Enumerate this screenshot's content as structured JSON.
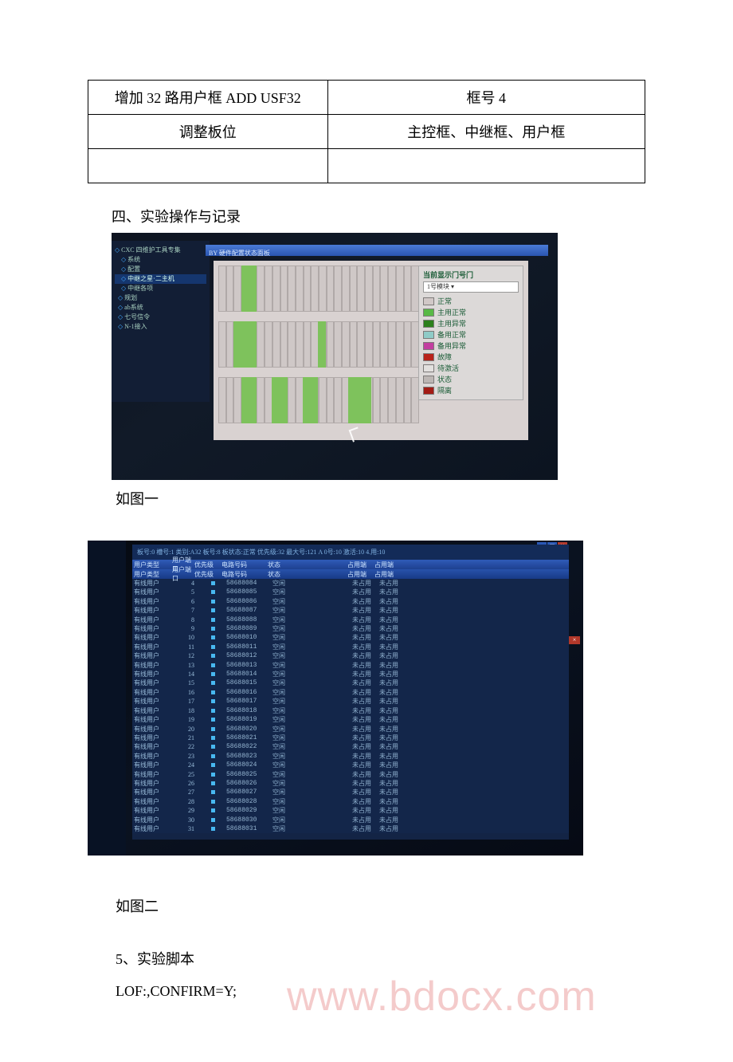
{
  "table": {
    "rows": [
      {
        "left": "增加 32 路用户框 ADD USF32",
        "right": "框号 4"
      },
      {
        "left": "调整板位",
        "right": "主控框、中继框、用户框"
      },
      {
        "left": "",
        "right": ""
      }
    ]
  },
  "heading_section4": "四、实验操作与记录",
  "caption1": "如图一",
  "caption2": "如图二",
  "heading_script": "5、实验脚本",
  "script_line1": "LOF:,CONFIRM=Y;",
  "watermark": "www.bdocx.com",
  "shot1": {
    "titlebar": "BY 硬件配置状态面板",
    "tree": [
      "CXC 四维护工具专集",
      "系统",
      "配置",
      "中继之星·二主机",
      "中继各项",
      "规划",
      "ab系统",
      "七号信令",
      "N-1接入"
    ],
    "tree_selected_index": 3,
    "legend": {
      "title": "当前显示门号门",
      "selector": "1号模块  ▾",
      "items": [
        {
          "label": "正常",
          "color": "#d1c8c7"
        },
        {
          "label": "主用正常",
          "color": "#58b946"
        },
        {
          "label": "主用异常",
          "color": "#2c801c"
        },
        {
          "label": "备用正常",
          "color": "#8fcbc7"
        },
        {
          "label": "备用异常",
          "color": "#c23fa0"
        },
        {
          "label": "故障",
          "color": "#b8231a"
        },
        {
          "label": "待激活",
          "color": "#e2e0de"
        },
        {
          "label": "状态",
          "color": "#bcb6b4"
        },
        {
          "label": "隔离",
          "color": "#a31c16"
        }
      ]
    }
  },
  "shot2": {
    "header_status": "板号:0   槽号:1   类别:A32   板号:8   板状态:正常   优先级:32   最大号:121 A 0号:10 激活:10 4.用:10",
    "column_groups": [
      "用户类型",
      "用户端口",
      "优先级",
      "电路号码",
      "状态",
      "占用端",
      "占用端"
    ],
    "rows": [
      {
        "type": "有线用户",
        "port": 4,
        "id": "58688084",
        "st": "空闲",
        "oc1": "未占用",
        "oc2": "未占用"
      },
      {
        "type": "有线用户",
        "port": 5,
        "id": "58688085",
        "st": "空闲",
        "oc1": "未占用",
        "oc2": "未占用"
      },
      {
        "type": "有线用户",
        "port": 6,
        "id": "58688086",
        "st": "空闲",
        "oc1": "未占用",
        "oc2": "未占用"
      },
      {
        "type": "有线用户",
        "port": 7,
        "id": "58688087",
        "st": "空闲",
        "oc1": "未占用",
        "oc2": "未占用"
      },
      {
        "type": "有线用户",
        "port": 8,
        "id": "58688088",
        "st": "空闲",
        "oc1": "未占用",
        "oc2": "未占用"
      },
      {
        "type": "有线用户",
        "port": 9,
        "id": "58688089",
        "st": "空闲",
        "oc1": "未占用",
        "oc2": "未占用"
      },
      {
        "type": "有线用户",
        "port": 10,
        "id": "58688010",
        "st": "空闲",
        "oc1": "未占用",
        "oc2": "未占用"
      },
      {
        "type": "有线用户",
        "port": 11,
        "id": "58688011",
        "st": "空闲",
        "oc1": "未占用",
        "oc2": "未占用"
      },
      {
        "type": "有线用户",
        "port": 12,
        "id": "58688012",
        "st": "空闲",
        "oc1": "未占用",
        "oc2": "未占用"
      },
      {
        "type": "有线用户",
        "port": 13,
        "id": "58688013",
        "st": "空闲",
        "oc1": "未占用",
        "oc2": "未占用"
      },
      {
        "type": "有线用户",
        "port": 14,
        "id": "58688014",
        "st": "空闲",
        "oc1": "未占用",
        "oc2": "未占用"
      },
      {
        "type": "有线用户",
        "port": 15,
        "id": "58688015",
        "st": "空闲",
        "oc1": "未占用",
        "oc2": "未占用"
      },
      {
        "type": "有线用户",
        "port": 16,
        "id": "58688016",
        "st": "空闲",
        "oc1": "未占用",
        "oc2": "未占用"
      },
      {
        "type": "有线用户",
        "port": 17,
        "id": "58688017",
        "st": "空闲",
        "oc1": "未占用",
        "oc2": "未占用"
      },
      {
        "type": "有线用户",
        "port": 18,
        "id": "58688018",
        "st": "空闲",
        "oc1": "未占用",
        "oc2": "未占用"
      },
      {
        "type": "有线用户",
        "port": 19,
        "id": "58688019",
        "st": "空闲",
        "oc1": "未占用",
        "oc2": "未占用"
      },
      {
        "type": "有线用户",
        "port": 20,
        "id": "58688020",
        "st": "空闲",
        "oc1": "未占用",
        "oc2": "未占用"
      },
      {
        "type": "有线用户",
        "port": 21,
        "id": "58688021",
        "st": "空闲",
        "oc1": "未占用",
        "oc2": "未占用"
      },
      {
        "type": "有线用户",
        "port": 22,
        "id": "58688022",
        "st": "空闲",
        "oc1": "未占用",
        "oc2": "未占用"
      },
      {
        "type": "有线用户",
        "port": 23,
        "id": "58688023",
        "st": "空闲",
        "oc1": "未占用",
        "oc2": "未占用"
      },
      {
        "type": "有线用户",
        "port": 24,
        "id": "58688024",
        "st": "空闲",
        "oc1": "未占用",
        "oc2": "未占用"
      },
      {
        "type": "有线用户",
        "port": 25,
        "id": "58688025",
        "st": "空闲",
        "oc1": "未占用",
        "oc2": "未占用"
      },
      {
        "type": "有线用户",
        "port": 26,
        "id": "58688026",
        "st": "空闲",
        "oc1": "未占用",
        "oc2": "未占用"
      },
      {
        "type": "有线用户",
        "port": 27,
        "id": "58688027",
        "st": "空闲",
        "oc1": "未占用",
        "oc2": "未占用"
      },
      {
        "type": "有线用户",
        "port": 28,
        "id": "58688028",
        "st": "空闲",
        "oc1": "未占用",
        "oc2": "未占用"
      },
      {
        "type": "有线用户",
        "port": 29,
        "id": "58688029",
        "st": "空闲",
        "oc1": "未占用",
        "oc2": "未占用"
      },
      {
        "type": "有线用户",
        "port": 30,
        "id": "58688030",
        "st": "空闲",
        "oc1": "未占用",
        "oc2": "未占用"
      },
      {
        "type": "有线用户",
        "port": 31,
        "id": "58688031",
        "st": "空闲",
        "oc1": "未占用",
        "oc2": "未占用"
      }
    ]
  }
}
